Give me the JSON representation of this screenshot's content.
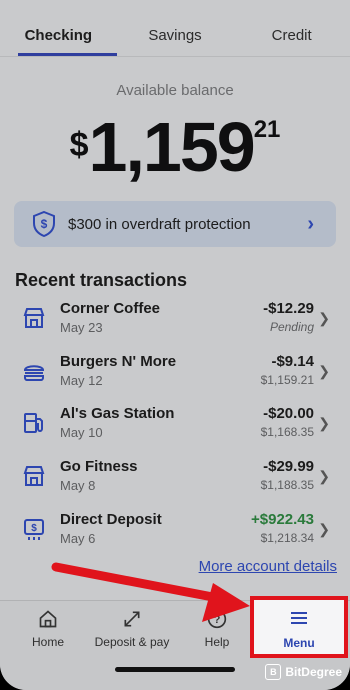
{
  "tabs": [
    "Checking",
    "Savings",
    "Credit"
  ],
  "balance": {
    "label": "Available balance",
    "currency": "$",
    "whole": "1,159",
    "cents": "21"
  },
  "overdraft": {
    "text": "$300 in overdraft protection",
    "chevron": "›"
  },
  "recent_title": "Recent transactions",
  "transactions": [
    {
      "icon": "store-icon",
      "name": "Corner Coffee",
      "date": "May 23",
      "amount": "-$12.29",
      "sub": "Pending"
    },
    {
      "icon": "burger-icon",
      "name": "Burgers N' More",
      "date": "May 12",
      "amount": "-$9.14",
      "sub": "$1,159.21"
    },
    {
      "icon": "gas-pump-icon",
      "name": "Al's Gas Station",
      "date": "May 10",
      "amount": "-$20.00",
      "sub": "$1,168.35"
    },
    {
      "icon": "store-icon",
      "name": "Go Fitness",
      "date": "May 8",
      "amount": "-$29.99",
      "sub": "$1,188.35"
    },
    {
      "icon": "deposit-icon",
      "name": "Direct Deposit",
      "date": "May 6",
      "amount": "+$922.43",
      "sub": "$1,218.34"
    }
  ],
  "more_link": "More account details",
  "nav": {
    "home": "Home",
    "deposit": "Deposit & pay",
    "help": "Help",
    "menu": "Menu"
  },
  "watermark": "BitDegree",
  "colors": {
    "accent": "#2d46b0",
    "positive": "#2a7a3b",
    "highlight": "#e0141c"
  }
}
